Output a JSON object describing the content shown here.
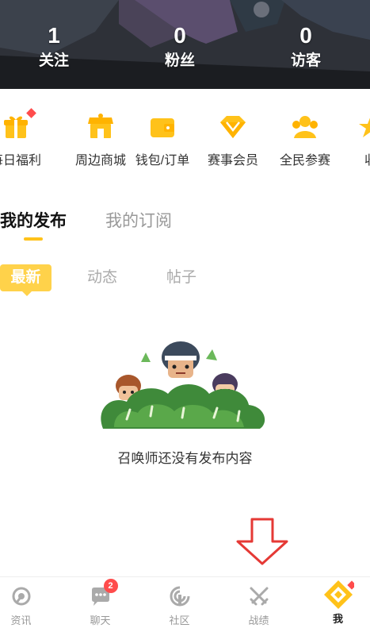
{
  "header": {
    "stats": [
      {
        "value": "1",
        "label": "关注"
      },
      {
        "value": "0",
        "label": "粉丝"
      },
      {
        "value": "0",
        "label": "访客"
      }
    ]
  },
  "features": [
    {
      "label": "每日福利",
      "icon": "gift-icon",
      "has_dot": true
    },
    {
      "label": "周边商城",
      "icon": "shop-icon"
    },
    {
      "label": "钱包/订单",
      "icon": "wallet-icon"
    },
    {
      "label": "赛事会员",
      "icon": "diamond-icon"
    },
    {
      "label": "全民参赛",
      "icon": "team-icon"
    },
    {
      "label": "收",
      "icon": "favorite-icon"
    }
  ],
  "tabs": {
    "main": [
      "我的发布",
      "我的订阅"
    ],
    "active_main": "我的发布",
    "sub": [
      "最新",
      "动态",
      "帖子"
    ],
    "active_sub": "最新"
  },
  "empty_state": {
    "message": "召唤师还没有发布内容",
    "illustration": "characters-peeking-from-bush-illustration"
  },
  "bottom_nav": [
    {
      "label": "资讯",
      "icon": "news-icon"
    },
    {
      "label": "聊天",
      "icon": "chat-icon",
      "badge": "2"
    },
    {
      "label": "社区",
      "icon": "community-icon"
    },
    {
      "label": "战绩",
      "icon": "crossed-swords-icon"
    },
    {
      "label": "我",
      "icon": "me-icon",
      "active": true
    }
  ],
  "colors": {
    "accent": "#ffc21a",
    "badge": "#ff4c4c",
    "banner_dark": "#2a2d33",
    "overlay_arrow": "#e53935"
  }
}
